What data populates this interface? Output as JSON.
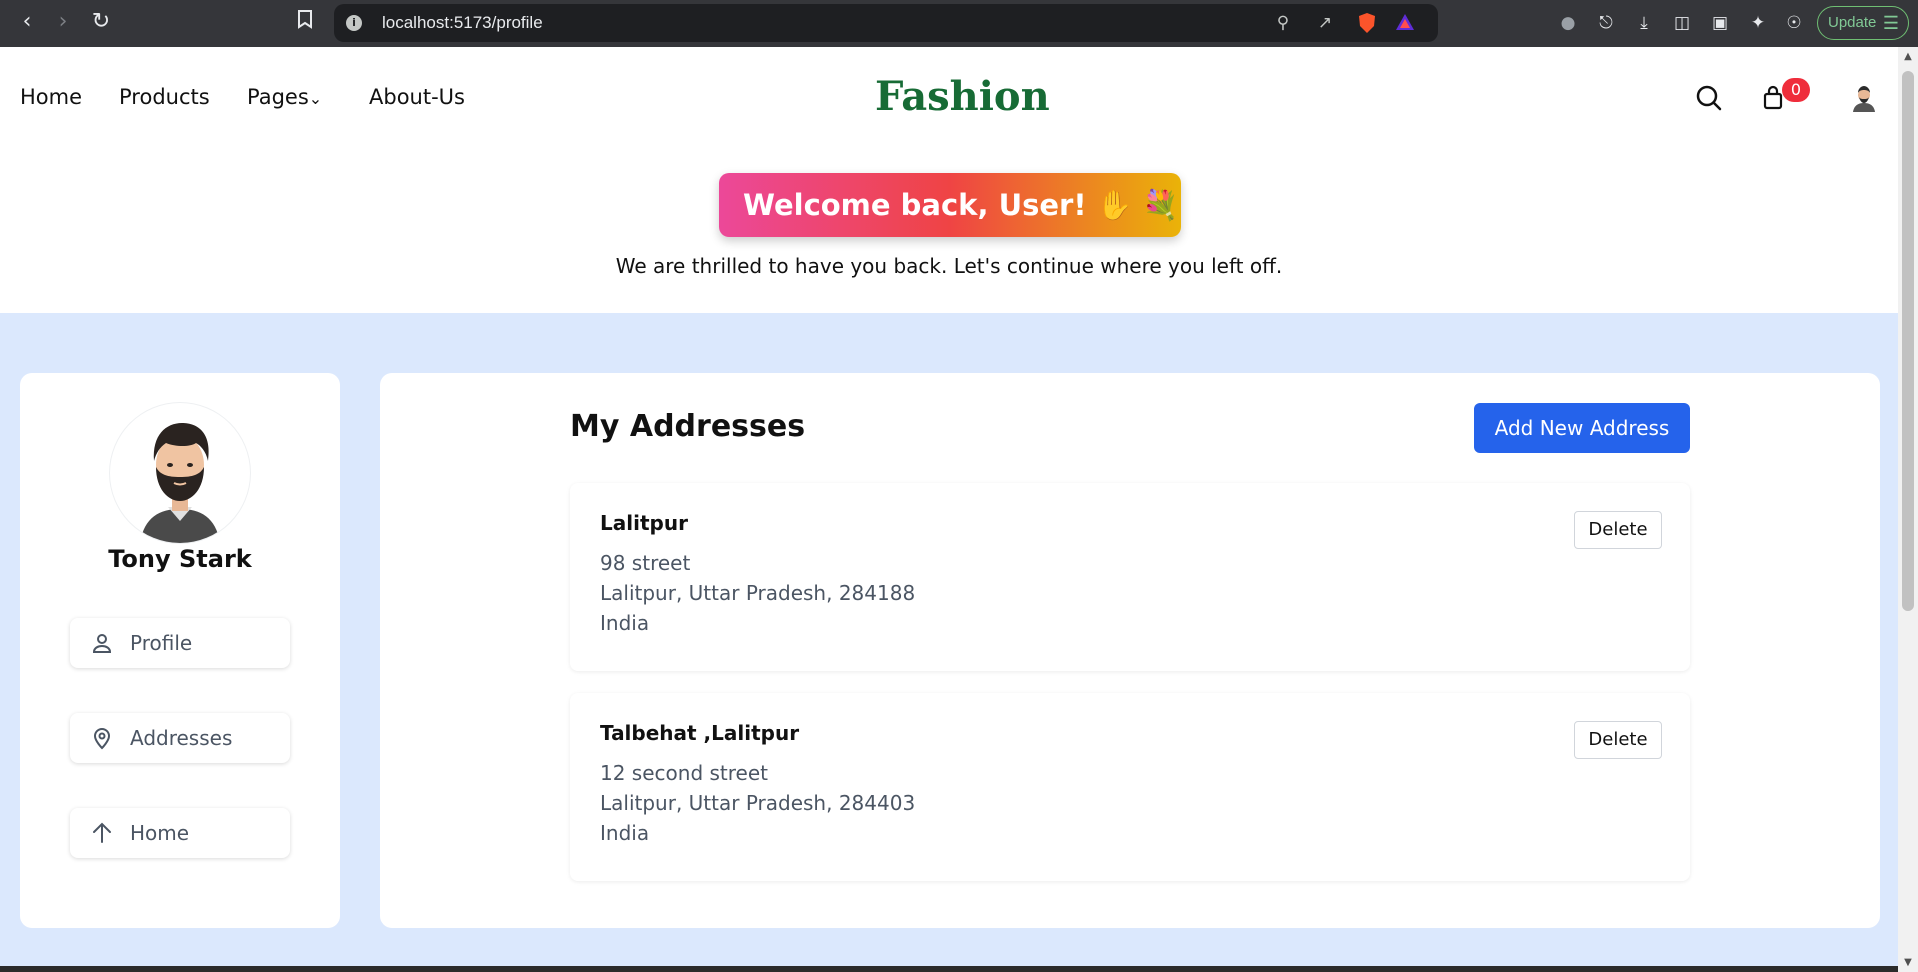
{
  "browser": {
    "url": "localhost:5173/profile",
    "update_label": "Update"
  },
  "nav": {
    "links": [
      "Home",
      "Products",
      "Pages",
      "About-Us"
    ],
    "brand": "Fashion",
    "cart_count": "0"
  },
  "hero": {
    "welcome": "Welcome back, User! ✋ 💐",
    "subtitle": "We are thrilled to have you back. Let's continue where you left off."
  },
  "sidebar": {
    "user_name": "Tony Stark",
    "items": [
      {
        "label": "Profile",
        "icon": "user-icon"
      },
      {
        "label": "Addresses",
        "icon": "map-pin-icon"
      },
      {
        "label": "Home",
        "icon": "arrow-up-icon"
      }
    ]
  },
  "main": {
    "title": "My Addresses",
    "add_button": "Add New Address",
    "delete_label": "Delete",
    "addresses": [
      {
        "city": "Lalitpur",
        "street": "98 street",
        "region": "Lalitpur, Uttar Pradesh, 284188",
        "country": "India"
      },
      {
        "city": "Talbehat ,Lalitpur",
        "street": "12 second street",
        "region": "Lalitpur, Uttar Pradesh, 284403",
        "country": "India"
      }
    ]
  },
  "colors": {
    "brand": "#176b35",
    "accent": "#2563eb",
    "page_bg": "#dbe8fd",
    "badge": "#ef2d3b"
  }
}
